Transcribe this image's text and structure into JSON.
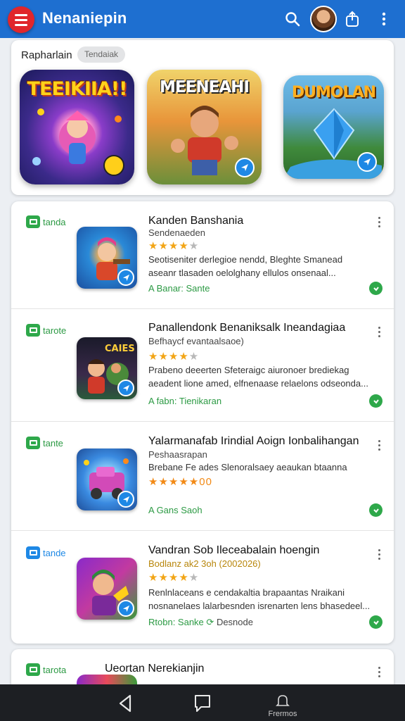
{
  "app": {
    "title": "Nenaniepin"
  },
  "header": {
    "menu_icon": "hamburger-icon",
    "search_icon": "search-icon",
    "avatar": "avatar",
    "share_icon": "share-icon",
    "more_icon": "more-vert-icon"
  },
  "featured": {
    "label": "Rapharlain",
    "chip": "Tendaiak",
    "games": [
      {
        "title": "TEEIKIIA!!"
      },
      {
        "title": "MEENEAHI"
      },
      {
        "title": "DUMOLAN"
      }
    ]
  },
  "list": [
    {
      "tag": "tanda",
      "title": "Kanden Banshania",
      "subtitle": "Sendenaeden",
      "stars": "★★★★",
      "desc1": "Seotiseniter derlegioe nendd, Bleghte Smanead",
      "desc2": "aseanr tlasaden oelolghany ellulos onsenaal...",
      "category": "A Banar: Sante"
    },
    {
      "tag": "tarote",
      "title": "Panallendonk Benaniksalk Ineandagiaa",
      "subtitle": "Befhaycf evantaalsaoe)",
      "stars": "★★★★",
      "desc1": "Prabeno deeerten Sfeteraigc aiuronoer brediekag",
      "desc2": "aeadent lione amed, elfnenaase relaelons odseonda...",
      "category": "A fabn: Tienikaran"
    },
    {
      "tag": "tante",
      "title": "Yalarmanafab Irindial Aoign Ionbalihangan",
      "subtitle": "Peshaasrapan",
      "stars": "★★★★★00",
      "desc1": "Brebane Fe ades Slenoralsaey aeaukan btaanna",
      "desc2": "",
      "category": "A Gans Saoh"
    },
    {
      "tag": "tande",
      "title": "Vandran Sob Ileceabalain hoengin",
      "subtitle": "Bodlanz ak2 3oh (2002026)",
      "stars": "★★★★",
      "desc1": "Renlnlaceans e cendakaltia brapaantas Nraikani",
      "desc2": "nosnanelaes lalarbesnden isrenarten lens bhasedeel...",
      "category": "Rtobn: Sanke",
      "extra": "Desnode"
    }
  ],
  "partial_row": {
    "tag": "tarota",
    "title": "Ueortan Nerekianjin"
  },
  "bottom_nav": {
    "back_icon": "back-icon",
    "home_icon": "home-icon",
    "bell_icon": "bell-icon",
    "bell_label": "Frermos"
  },
  "colors": {
    "appbar": "#1e6fd0",
    "menu": "#e0262b",
    "accent_green": "#2ea84a",
    "accent_blue": "#1e88e5",
    "star": "#f2a516"
  }
}
